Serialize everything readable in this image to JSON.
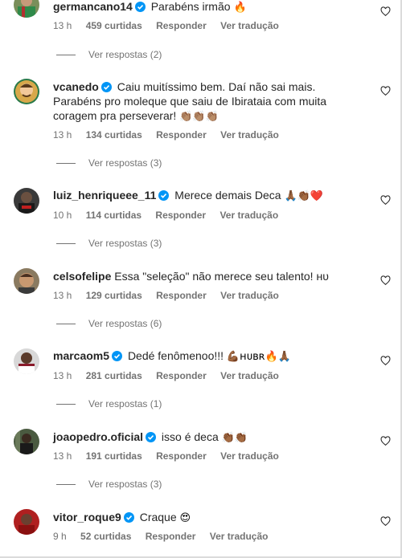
{
  "comments": [
    {
      "username": "germancano14",
      "text": "Parabéns irmão",
      "emoji": "🔥",
      "time": "13 h",
      "likes": "459 curtidas",
      "reply": "Responder",
      "translate": "Ver tradução",
      "view_replies": "Ver respostas (2)"
    },
    {
      "username": "vcanedo",
      "text": "Caiu muitíssimo bem. Daí não sai mais. Parabéns pro moleque que saiu de Ibirataia com muita coragem pra perseverar!",
      "emoji": "👏🏽👏🏽👏🏽",
      "time": "13 h",
      "likes": "134 curtidas",
      "reply": "Responder",
      "translate": "Ver tradução",
      "view_replies": "Ver respostas (3)"
    },
    {
      "username": "luiz_henriqueee_11",
      "text": "Merece demais Deca",
      "emoji": "🙏🏾👏🏾❤️",
      "time": "10 h",
      "likes": "114 curtidas",
      "reply": "Responder",
      "translate": "Ver tradução",
      "view_replies": "Ver respostas (3)"
    },
    {
      "username": "celsofelipe",
      "text": "Essa \"seleção\" não merece seu talento! ʜᴜ",
      "emoji": "",
      "time": "13 h",
      "likes": "129 curtidas",
      "reply": "Responder",
      "translate": "Ver tradução",
      "view_replies": "Ver respostas (6)"
    },
    {
      "username": "marcaom5",
      "text": "Dedé fenômenoo!!!",
      "emoji": "💪🏾ʜᴜʙʀ🔥🙏🏾",
      "time": "13 h",
      "likes": "281 curtidas",
      "reply": "Responder",
      "translate": "Ver tradução",
      "view_replies": "Ver respostas (1)"
    },
    {
      "username": "joaopedro.oficial",
      "text": "isso é deca",
      "emoji": "👏🏾👏🏾",
      "time": "13 h",
      "likes": "191 curtidas",
      "reply": "Responder",
      "translate": "Ver tradução",
      "view_replies": "Ver respostas (3)"
    },
    {
      "username": "vitor_roque9",
      "text": "Craque",
      "emoji": "😍",
      "time": "9 h",
      "likes": "52 curtidas",
      "reply": "Responder",
      "translate": "Ver tradução",
      "view_replies": ""
    }
  ],
  "colors": {
    "verified": "#0095f6",
    "secondary_text": "#737373"
  }
}
